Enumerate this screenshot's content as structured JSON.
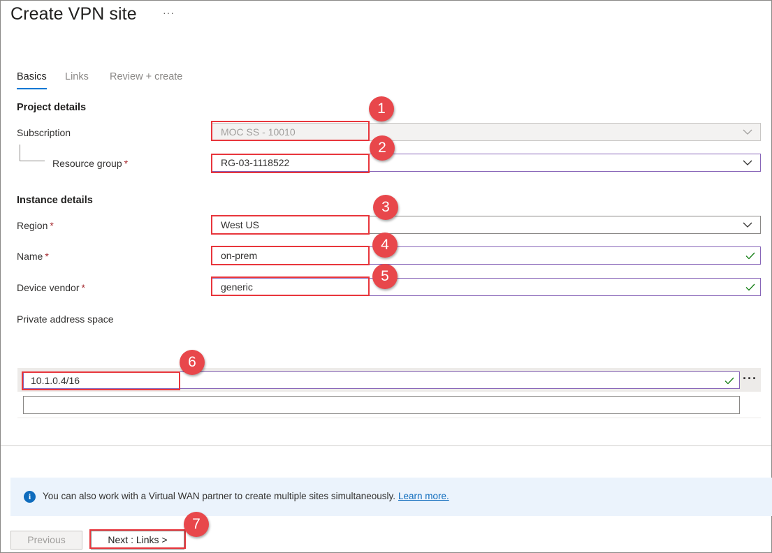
{
  "header": {
    "title": "Create VPN site",
    "more_label": "···"
  },
  "tabs": [
    {
      "label": "Basics",
      "active": true
    },
    {
      "label": "Links",
      "active": false
    },
    {
      "label": "Review + create",
      "active": false
    }
  ],
  "project_details": {
    "heading": "Project details",
    "subscription_label": "Subscription",
    "subscription_value": "MOC SS - 10010",
    "resource_group_label": "Resource group",
    "resource_group_value": "RG-03-1118522"
  },
  "instance_details": {
    "heading": "Instance details",
    "region_label": "Region",
    "region_value": "West US",
    "name_label": "Name",
    "name_value": "on-prem",
    "vendor_label": "Device vendor",
    "vendor_value": "generic"
  },
  "address_space": {
    "label": "Private address space",
    "rows": [
      {
        "value": "10.1.0.4/16"
      },
      {
        "value": ""
      }
    ],
    "row_more_label": "···"
  },
  "required_marker": "*",
  "info_bar": {
    "text": "You can also work with a Virtual WAN partner to create multiple sites simultaneously.",
    "link": "Learn more.",
    "icon": "info-icon"
  },
  "footer": {
    "previous_label": "Previous",
    "next_label": "Next : Links >"
  },
  "callouts": [
    "1",
    "2",
    "3",
    "4",
    "5",
    "6",
    "7"
  ],
  "colors": {
    "accent": "#0078d4",
    "callout": "#e8363c",
    "valid": "#107c10",
    "focus_border": "#8764b8",
    "info_background": "#ebf3fc"
  }
}
